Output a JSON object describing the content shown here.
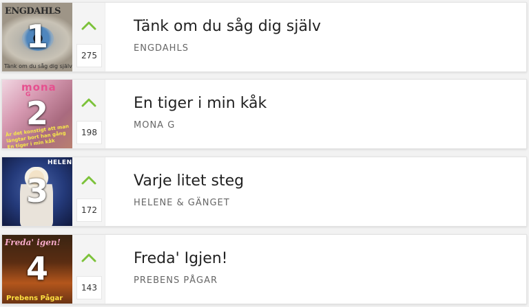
{
  "colors": {
    "accent_up": "#7cc23a",
    "title": "#222222",
    "artist": "#666666"
  },
  "chart": [
    {
      "rank": "1",
      "title": "Tänk om du såg dig själv",
      "artist": "ENGDAHLS",
      "votes": "275",
      "cover": {
        "brand": "ENGDAHLS",
        "subtitle": "Tänk om du såg dig själv"
      }
    },
    {
      "rank": "2",
      "title": "En tiger i min kåk",
      "artist": "MONA G",
      "votes": "198",
      "cover": {
        "brand": "mona",
        "brand2": "G",
        "tagline": "Är det konstigt att man längtar bort han gång En tiger i min kåk"
      }
    },
    {
      "rank": "3",
      "title": "Varje litet steg",
      "artist": "HELENE & GÄNGET",
      "votes": "172",
      "cover": {
        "brand": "HELENE"
      }
    },
    {
      "rank": "4",
      "title": "Freda' Igjen!",
      "artist": "PREBENS PÅGAR",
      "votes": "143",
      "cover": {
        "brand": "Freda' igen!",
        "subtitle": "Prebens Pågar"
      }
    }
  ]
}
